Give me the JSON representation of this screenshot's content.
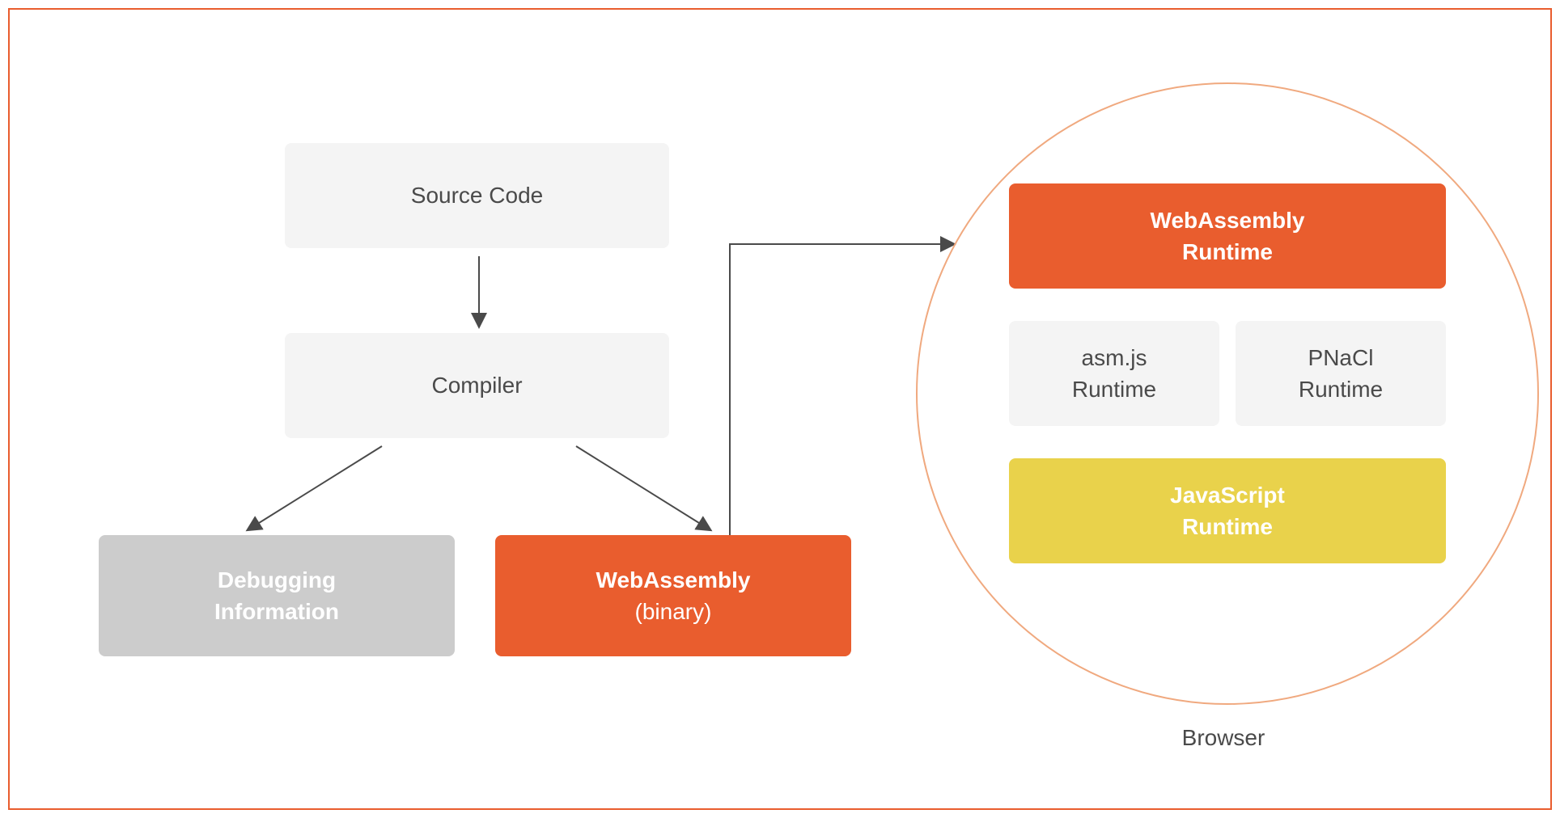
{
  "boxes": {
    "source_code": {
      "label": "Source Code"
    },
    "compiler": {
      "label": "Compiler"
    },
    "debugging": {
      "line1": "Debugging",
      "line2": "Information"
    },
    "webassembly": {
      "line1": "WebAssembly",
      "line2": "(binary)"
    },
    "wasm_runtime": {
      "line1": "WebAssembly",
      "line2": "Runtime"
    },
    "asmjs_runtime": {
      "line1": "asm.js",
      "line2": "Runtime"
    },
    "pnacl_runtime": {
      "line1": "PNaCl",
      "line2": "Runtime"
    },
    "js_runtime": {
      "line1": "JavaScript",
      "line2": "Runtime"
    }
  },
  "browser_label": "Browser",
  "colors": {
    "frame_border": "#e95d2e",
    "light_box": "#f4f4f4",
    "gray_box": "#cccccc",
    "orange_box": "#e95d2e",
    "yellow_box": "#e9d24b",
    "circle_border": "#f0a97f",
    "arrow": "#4a4a4a",
    "text_dark": "#4a4a4a",
    "text_light": "#ffffff"
  }
}
